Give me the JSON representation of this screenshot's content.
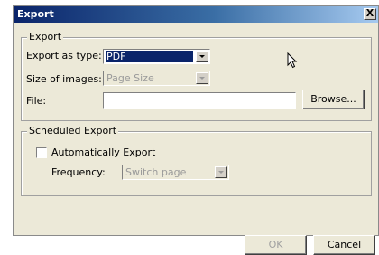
{
  "window": {
    "title": "Export",
    "close_glyph": "X"
  },
  "export_group": {
    "legend": "Export",
    "type_label": "Export as type:",
    "type_value": "PDF",
    "size_label": "Size of images:",
    "size_value": "Page Size",
    "file_label": "File:",
    "file_value": "",
    "browse_label": "Browse..."
  },
  "scheduled_group": {
    "legend": "Scheduled Export",
    "auto_label": "Automatically Export",
    "auto_checked": false,
    "frequency_label": "Frequency:",
    "frequency_value": "Switch page"
  },
  "footer": {
    "ok_label": "OK",
    "cancel_label": "Cancel"
  },
  "icons": {
    "cursor": "mouse-pointer-icon",
    "dropdown": "chevron-down-icon"
  }
}
